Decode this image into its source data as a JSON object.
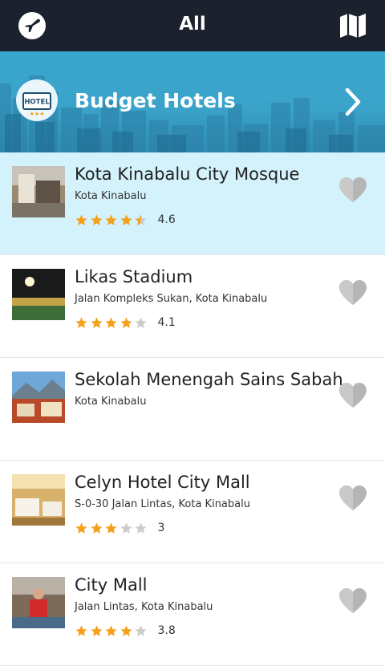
{
  "header": {
    "title": "All",
    "left_icon": "airplane-icon",
    "right_icon": "map-icon"
  },
  "banner": {
    "title": "Budget Hotels",
    "badge_text": "HOTEL",
    "badge_icon": "hotel-badge-icon",
    "chevron_icon": "chevron-right-icon"
  },
  "colors": {
    "topbar": "#1b222e",
    "banner": "#3aa7cf",
    "selected_row": "#d3f2fb",
    "star_filled": "#f5a01a",
    "star_empty": "#cccccc",
    "heart": "#b5b5b5"
  },
  "places": [
    {
      "name": "Kota Kinabalu City Mosque",
      "address": "Kota Kinabalu",
      "rating": 4.6,
      "rating_label": "4.6",
      "selected": true
    },
    {
      "name": "Likas Stadium",
      "address": "Jalan Kompleks Sukan, Kota Kinabalu",
      "rating": 4.1,
      "rating_label": "4.1",
      "selected": false
    },
    {
      "name": "Sekolah Menengah Sains Sabah",
      "address": "Kota Kinabalu",
      "rating": null,
      "rating_label": "",
      "selected": false
    },
    {
      "name": "Celyn Hotel City Mall",
      "address": "S-0-30 Jalan Lintas, Kota Kinabalu",
      "rating": 3,
      "rating_label": "3",
      "selected": false
    },
    {
      "name": "City Mall",
      "address": "Jalan Lintas, Kota Kinabalu",
      "rating": 3.8,
      "rating_label": "3.8",
      "selected": false
    }
  ]
}
